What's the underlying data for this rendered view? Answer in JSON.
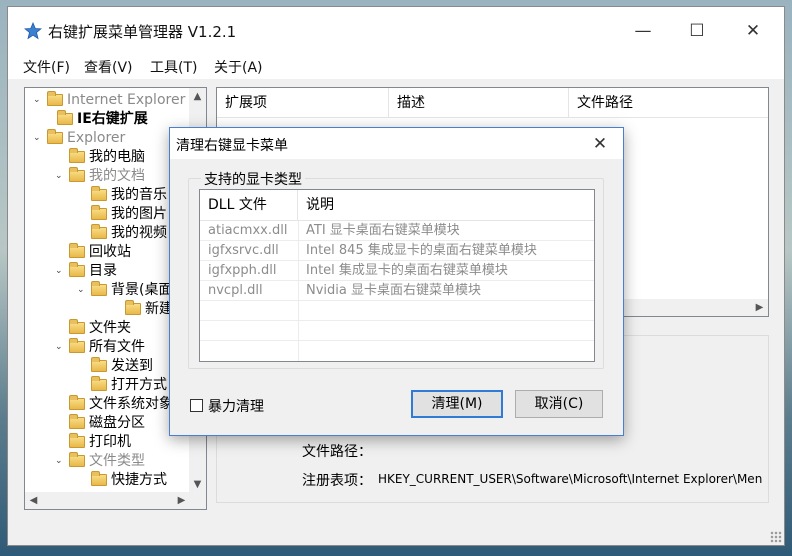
{
  "app": {
    "title": "右键扩展菜单管理器 V1.2.1",
    "menus": [
      "文件(F)",
      "查看(V)",
      "工具(T)",
      "关于(A)"
    ]
  },
  "tree": {
    "items": [
      {
        "label": "Internet Explorer",
        "style": "gray",
        "exp": "⌄"
      },
      {
        "label": "IE右键扩展",
        "style": "bold",
        "exp": ""
      },
      {
        "label": "Explorer",
        "style": "gray",
        "exp": "⌄"
      },
      {
        "label": "我的电脑",
        "style": "",
        "exp": ""
      },
      {
        "label": "我的文档",
        "style": "gray",
        "exp": "⌄"
      },
      {
        "label": "我的音乐",
        "style": "",
        "exp": ""
      },
      {
        "label": "我的图片",
        "style": "",
        "exp": ""
      },
      {
        "label": "我的视频",
        "style": "",
        "exp": ""
      },
      {
        "label": "回收站",
        "style": "",
        "exp": ""
      },
      {
        "label": "目录",
        "style": "",
        "exp": "⌄"
      },
      {
        "label": "背景(桌面)",
        "style": "",
        "exp": "⌄"
      },
      {
        "label": "新建",
        "style": "",
        "exp": ""
      },
      {
        "label": "文件夹",
        "style": "",
        "exp": ""
      },
      {
        "label": "所有文件",
        "style": "",
        "exp": "⌄"
      },
      {
        "label": "发送到",
        "style": "",
        "exp": ""
      },
      {
        "label": "打开方式",
        "style": "",
        "exp": ""
      },
      {
        "label": "文件系统对象",
        "style": "",
        "exp": ""
      },
      {
        "label": "磁盘分区",
        "style": "",
        "exp": ""
      },
      {
        "label": "打印机",
        "style": "",
        "exp": ""
      },
      {
        "label": "文件类型",
        "style": "gray",
        "exp": "⌄"
      },
      {
        "label": "快捷方式",
        "style": "",
        "exp": ""
      }
    ]
  },
  "list": {
    "columns": [
      "扩展项",
      "描述",
      "文件路径"
    ]
  },
  "detail": {
    "path_label": "文件路径：",
    "path_value": "",
    "reg_label": "注册表项：",
    "reg_value": "HKEY_CURRENT_USER\\Software\\Microsoft\\Internet Explorer\\Men"
  },
  "dialog": {
    "title": "清理右键显卡菜单",
    "group_title": "支持的显卡类型",
    "columns": [
      "DLL 文件",
      "说明"
    ],
    "rows": [
      {
        "dll": "atiacmxx.dll",
        "desc": "ATI 显卡桌面右键菜单模块"
      },
      {
        "dll": "igfxsrvc.dll",
        "desc": "Intel 845 集成显卡的桌面右键菜单模块"
      },
      {
        "dll": "igfxpph.dll",
        "desc": "Intel 集成显卡的桌面右键菜单模块"
      },
      {
        "dll": "nvcpl.dll",
        "desc": "Nvidia 显卡桌面右键菜单模块"
      }
    ],
    "checkbox_label": "暴力清理",
    "checkbox_checked": false,
    "clean_button": "清理(M)",
    "cancel_button": "取消(C)"
  },
  "colors": {
    "dialog_border": "#4a7fd0",
    "primary_button_border": "#2f7bd6",
    "folder": "#e8b84a"
  }
}
